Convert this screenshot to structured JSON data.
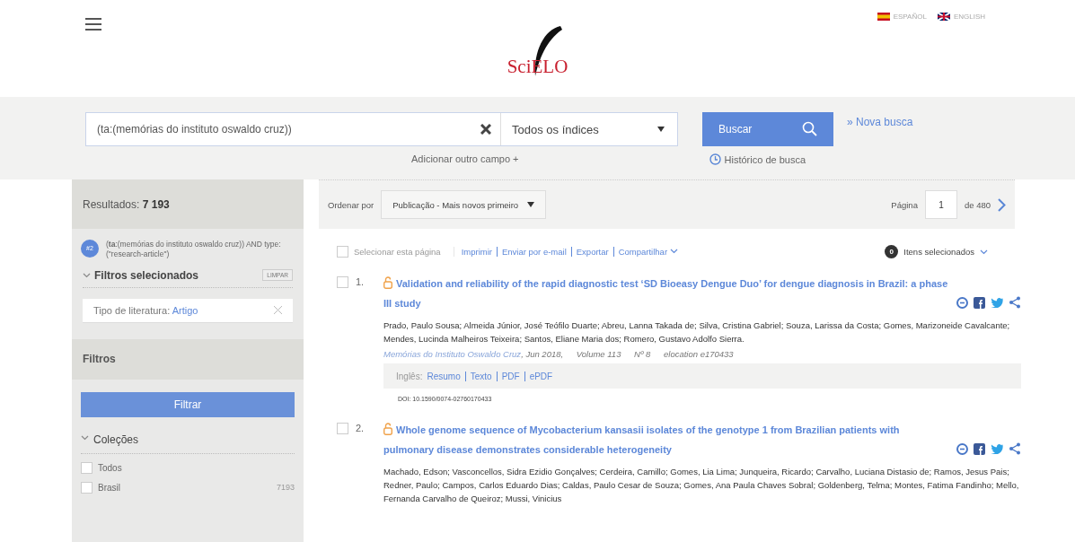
{
  "header": {
    "logo": "SciELO",
    "languages": [
      {
        "label": "ESPAÑOL",
        "selected": false
      },
      {
        "label": "ENGLISH",
        "selected": false
      }
    ]
  },
  "search": {
    "value": "(ta:(memórias do instituto oswaldo cruz))",
    "index": "Todos os índices",
    "button": "Buscar",
    "new_search": "» Nova busca",
    "add_field": "Adicionar outro campo +",
    "history": "Histórico de busca"
  },
  "sidebar": {
    "results_label": "Resultados:",
    "results_count": "7 193",
    "query_badge": "#2",
    "query": "(**ta**:(memórias do instituto oswaldo cruz)) AND type:(\"research-article\")",
    "selected_filters": {
      "title": "Filtros selecionados",
      "clear": "LIMPAR",
      "expanded": true,
      "items": [
        {
          "label": "Tipo de literatura:",
          "value": "Artigo"
        }
      ]
    },
    "filters_title": "Filtros",
    "filter_button": "Filtrar",
    "collections": {
      "title": "Coleções",
      "expanded": true,
      "items": [
        {
          "label": "Todos",
          "checked": false
        },
        {
          "label": "Brasil",
          "count": "7193",
          "checked": false
        }
      ]
    }
  },
  "toolbar": {
    "sort_label": "Ordenar por",
    "sort_value": "Publicação - Mais novos primeiro",
    "page_label": "Página",
    "page": "1",
    "page_total": "de 480"
  },
  "actions": {
    "select_page": "Selecionar esta página",
    "select_checked": false,
    "links": [
      "Imprimir",
      "Enviar por e-mail",
      "Exportar",
      "Compartilhar"
    ],
    "selected_count": "0",
    "selected_label": "Itens selecionados"
  },
  "results": [
    {
      "number": "1.",
      "checked": false,
      "title": "Validation and reliability of the rapid diagnostic test ‘SD Bioeasy Dengue Duo’ for dengue diagnosis in Brazil: a phase III study",
      "authors": "Prado, Paulo Sousa; Almeida Júnior, José Teófilo Duarte; Abreu, Lanna Takada de; Silva, Cristina Gabriel; Souza, Larissa da Costa; Gomes, Marizoneide Cavalcante; Mendes, Lucinda Malheiros Teixeira; Santos, Eliane Maria dos; Romero, Gustavo Adolfo Sierra.",
      "journal": "Memórias do Instituto Oswaldo Cruz",
      "date": ", Jun 2018,",
      "volume": "Volume 113",
      "issue": "Nº 8",
      "elocation": "elocation e170433",
      "language": "Inglês:",
      "formats": [
        "Resumo",
        "Texto",
        "PDF",
        "ePDF"
      ],
      "doi": "DOI: 10.1590/0074-02760170433"
    },
    {
      "number": "2.",
      "checked": false,
      "title": "Whole genome sequence of Mycobacterium kansasii isolates of the genotype 1 from Brazilian patients with pulmonary disease demonstrates considerable heterogeneity",
      "authors": "Machado, Edson; Vasconcellos, Sidra Ezidio Gonçalves; Cerdeira, Camillo; Gomes, Lia Lima; Junqueira, Ricardo; Carvalho, Luciana Distasio de; Ramos, Jesus Pais; Redner, Paulo; Campos, Carlos Eduardo Dias; Caldas, Paulo Cesar de Souza; Gomes, Ana Paula Chaves Sobral; Goldenberg, Telma; Montes, Fatima Fandinho; Mello, Fernanda Carvalho de Queiroz; Mussi, Vinicius"
    }
  ]
}
